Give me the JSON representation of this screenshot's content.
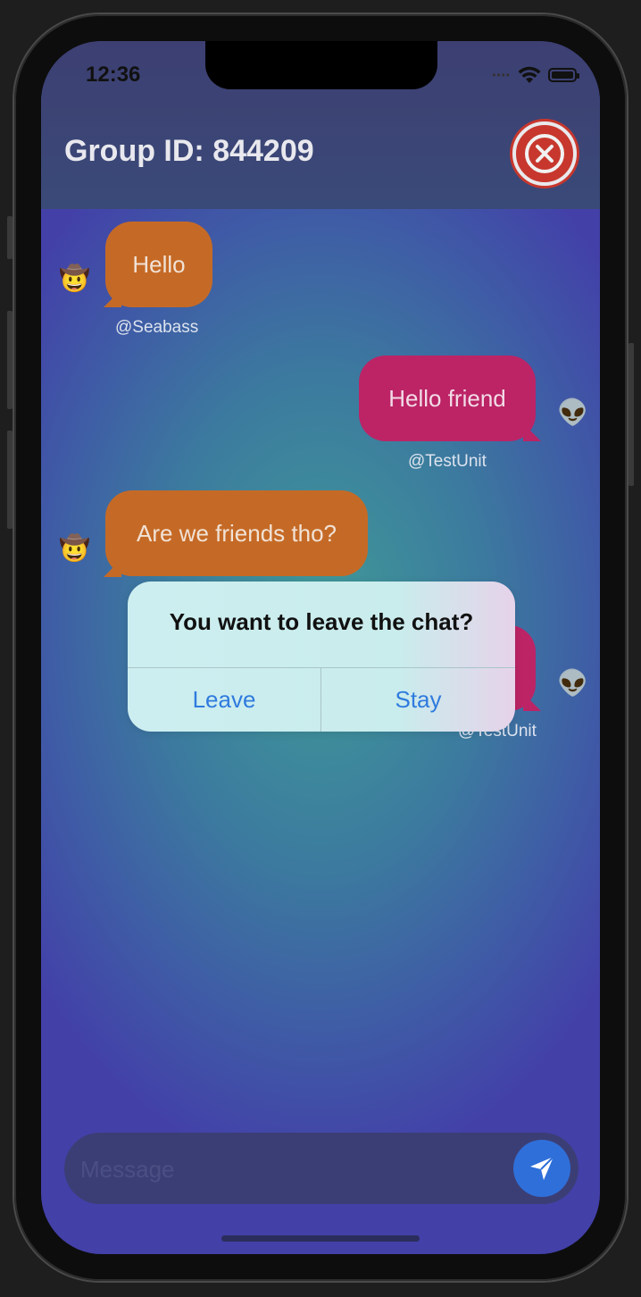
{
  "status_bar": {
    "time": "12:36"
  },
  "header": {
    "title": "Group ID: 844209"
  },
  "messages": [
    {
      "text": "Hello",
      "handle": "@Seabass",
      "avatar": "🤠",
      "side": "left"
    },
    {
      "text": "Hello friend",
      "handle": "@TestUnit",
      "avatar": "👽",
      "side": "right"
    },
    {
      "text": "Are we friends tho?",
      "handle": "",
      "avatar": "🤠",
      "side": "left"
    },
    {
      "text": "",
      "handle": "@TestUnit",
      "avatar": "👽",
      "side": "right"
    }
  ],
  "alert": {
    "title": "You want to leave the chat?",
    "leave_label": "Leave",
    "stay_label": "Stay"
  },
  "composer": {
    "placeholder": "Message"
  },
  "colors": {
    "left_bubble": "#c56a26",
    "right_bubble": "#bc2466",
    "close_button": "#c7372d",
    "send_button": "#2f6fd9",
    "alert_button_text": "#2f7bde"
  },
  "icons": {
    "close": "close-icon",
    "send": "send-icon",
    "wifi": "wifi-icon",
    "battery": "battery-icon"
  }
}
